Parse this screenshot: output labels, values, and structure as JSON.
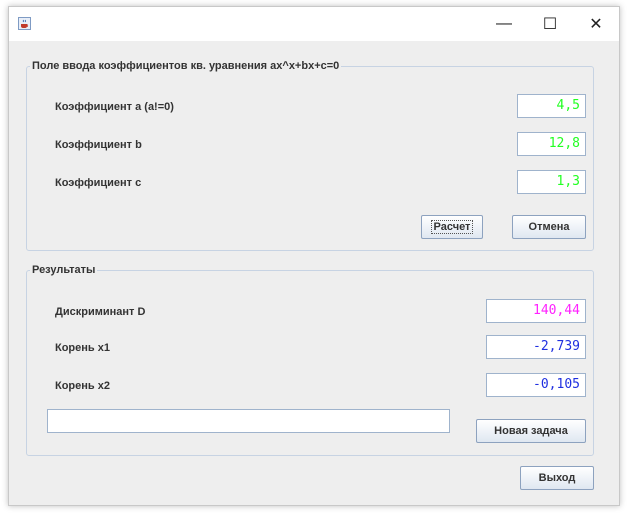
{
  "window": {
    "icon": "java-coffee-icon",
    "controls": {
      "minimize": "—",
      "maximize": "☐",
      "close": "✕"
    }
  },
  "input_group": {
    "legend": "Поле ввода коэффициентов кв. уравнения ax^x+bx+c=0",
    "coef_a": {
      "label": "Коэффициент а (а!=0)",
      "value": "4,5"
    },
    "coef_b": {
      "label": "Коэффициент b",
      "value": "12,8"
    },
    "coef_c": {
      "label": "Коэффициент с",
      "value": "1,3"
    },
    "calc_button": "Расчет",
    "cancel_button": "Отмена"
  },
  "results_group": {
    "legend": "Результаты",
    "discriminant": {
      "label": "Дискриминант D",
      "value": "140,44"
    },
    "root_x1": {
      "label": "Корень х1",
      "value": "-2,739"
    },
    "root_x2": {
      "label": "Корень х2",
      "value": "-0,105"
    },
    "status_text": "",
    "new_task_button": "Новая задача"
  },
  "exit_button": "Выход",
  "colors": {
    "coefficient_value": "#22ff22",
    "discriminant_value": "#ff22ff",
    "root_value": "#1f2fe0"
  }
}
